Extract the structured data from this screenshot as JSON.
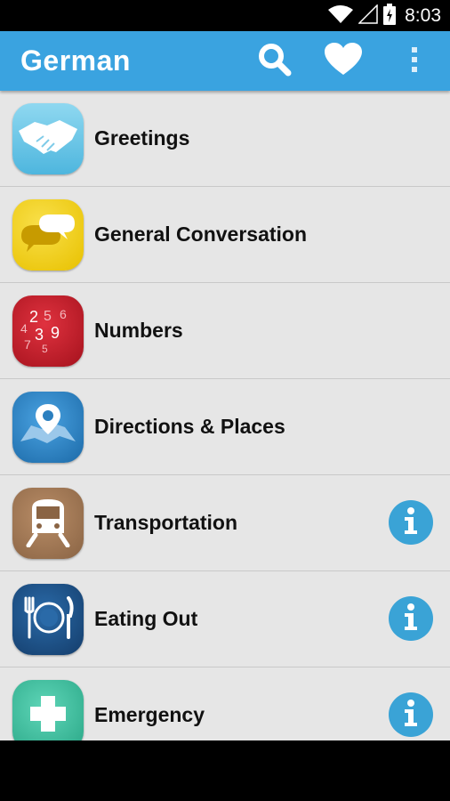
{
  "status_bar": {
    "time": "8:03"
  },
  "app_bar": {
    "title": "German"
  },
  "categories": [
    {
      "label": "Greetings",
      "icon": "handshake-icon",
      "color": "#6cc6e6",
      "has_info": false
    },
    {
      "label": "General Conversation",
      "icon": "speech-bubbles-icon",
      "color": "#f1cf12",
      "has_info": false
    },
    {
      "label": "Numbers",
      "icon": "numbers-icon",
      "color": "#c4212f",
      "has_info": false
    },
    {
      "label": "Directions & Places",
      "icon": "map-pin-icon",
      "color": "#2b7fbf",
      "has_info": false
    },
    {
      "label": "Transportation",
      "icon": "train-icon",
      "color": "#a47b58",
      "has_info": true
    },
    {
      "label": "Eating Out",
      "icon": "plate-cutlery-icon",
      "color": "#1d4f86",
      "has_info": true
    },
    {
      "label": "Emergency",
      "icon": "medical-cross-icon",
      "color": "#3cbf9f",
      "has_info": true
    }
  ],
  "colors": {
    "accent": "#3aa3e0",
    "info": "#3aa3d6",
    "list_bg": "#e6e6e6"
  }
}
